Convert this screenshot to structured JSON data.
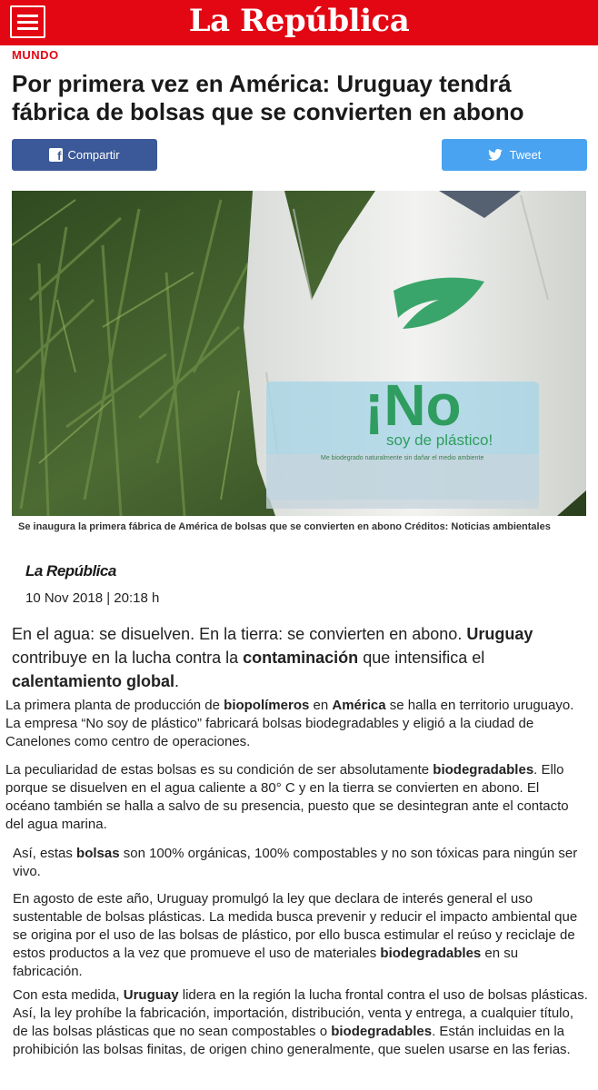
{
  "header": {
    "logo": "La República",
    "menu_icon": "hamburger-menu-icon",
    "color": "#e30613"
  },
  "article": {
    "section": "MUNDO",
    "headline": "Por primera vez en América: Uruguay tendrá fábrica de bolsas que se convierten en abono",
    "share": {
      "facebook_label": "Compartir",
      "twitter_label": "Tweet",
      "facebook_color": "#3b5998",
      "twitter_color": "#4aa3f0"
    },
    "image": {
      "bag_text_big": "¡No",
      "bag_text_sub": "soy de plástico!",
      "bag_small_text": "Me biodegrado naturalmente sin dañar el medio ambiente",
      "caption": "Se inaugura la primera fábrica de América de bolsas que se convierten en abono Créditos: Noticias ambientales"
    },
    "author": "La República",
    "date": "10 Nov 2018 | 20:18 h",
    "lead": {
      "t1": "En el agua: se disuelven. En la tierra: se convierten en abono. ",
      "b1": "Uruguay",
      "t2": " contribuye en la lucha contra la ",
      "b2": "contaminación",
      "t3": " que intensifica el ",
      "b3": "calentamiento global",
      "t4": "."
    },
    "p1": {
      "t1": "La primera planta de producción de ",
      "b1": "biopolímeros",
      "t2": " en ",
      "b2": "América",
      "t3": " se halla en territorio uruguayo. La empresa “No soy de plástico” fabricará bolsas biodegradables y eligió a la ciudad de Canelones como centro de operaciones."
    },
    "p2": {
      "t1": "La peculiaridad de estas bolsas es su condición de ser absolutamente ",
      "b1": "biodegradables",
      "t2": ". Ello porque se disuelven en el agua caliente a 80° C y en la tierra se convierten en abono. El océano también se halla a salvo de su presencia, puesto que se desintegran ante el contacto del agua marina."
    },
    "p3": {
      "t1": "Así, estas ",
      "b1": "bolsas",
      "t2": " son 100% orgánicas, 100% compostables y no son tóxicas para ningún ser vivo."
    },
    "p4": {
      "t1": "En agosto de este año, Uruguay promulgó la ley que declara de interés general el uso sustentable de bolsas plásticas. La medida busca prevenir y reducir el impacto ambiental que se origina por el uso de las bolsas de plástico, por ello busca estimular el reúso y reciclaje de estos productos a la vez que promueve el uso de materiales ",
      "b1": "biodegradables",
      "t2": " en su fabricación."
    },
    "p5": {
      "t1": "Con esta medida, ",
      "b1": "Uruguay",
      "t2": " lidera en la región la lucha frontal contra el uso de bolsas plásticas. Así, la ley  prohíbe la fabricación, importación, distribución, venta y entrega, a cualquier título, de las bolsas plásticas que no sean compostables o ",
      "b2": "biodegradables",
      "t3": ". Están incluidas en la prohibición las bolsas finitas, de origen chino generalmente, que suelen usarse en las ferias."
    }
  }
}
